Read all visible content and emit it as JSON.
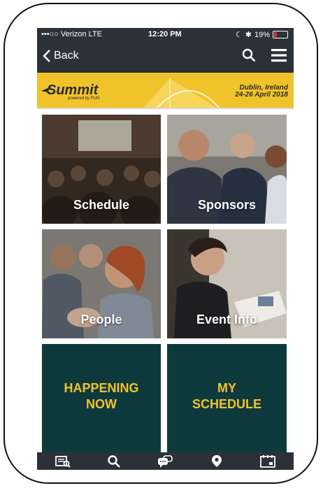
{
  "status": {
    "carrier": "•••○○ Verizon  LTE",
    "time": "12:20 PM",
    "battery": "19%"
  },
  "nav": {
    "back_label": "Back"
  },
  "banner": {
    "logo": "Summit",
    "powered": "powered by PUG",
    "location": "Dublin, Ireland",
    "dates": "24-26 April 2018"
  },
  "tiles": {
    "schedule": "Schedule",
    "sponsors": "Sponsors",
    "people": "People",
    "event_info": "Event Info",
    "happening_now_1": "HAPPENING",
    "happening_now_2": "NOW",
    "my_schedule_1": "MY",
    "my_schedule_2": "SCHEDULE"
  },
  "colors": {
    "bar": "#2c3138",
    "accent": "#f1c32a",
    "teal": "#0f3a3d"
  },
  "tabbar": {
    "icons": [
      "newspaper-search-icon",
      "search-icon",
      "chat-bubbles-icon",
      "location-pin-icon",
      "calendar-icon"
    ]
  }
}
